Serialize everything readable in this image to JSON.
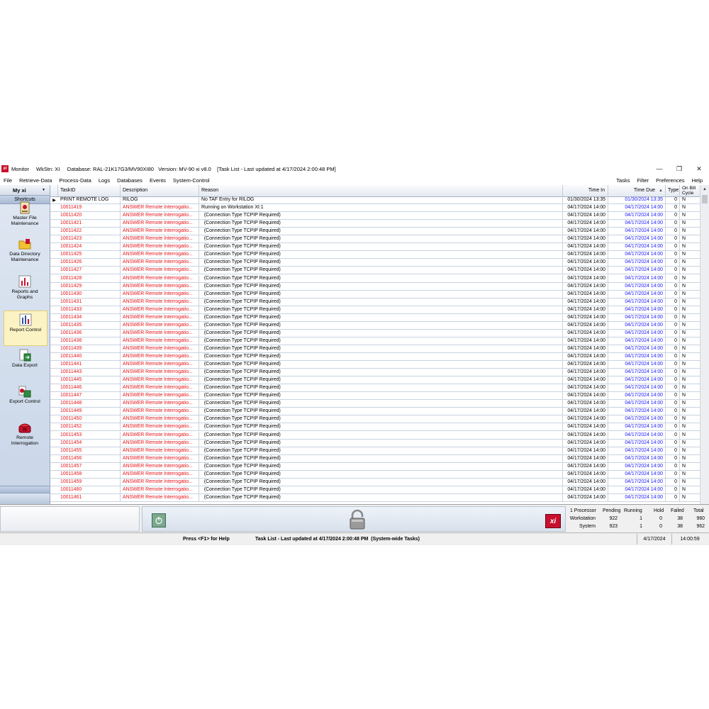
{
  "window": {
    "app_name": "Monitor",
    "logo_text": "xi",
    "title_info": "WkStn: XI     Database: RAL-21K17G3/MV90XI80   Version: MV-90 xi v8.0    [Task List - Last updated at 4/17/2024 2:00:48 PM]",
    "minimize": "—",
    "restore": "❐",
    "close": "✕"
  },
  "menu": {
    "left": [
      "File",
      "Retrieve-Data",
      "Process-Data",
      "Logs",
      "Databases",
      "Events",
      "System-Control"
    ],
    "right": [
      "Tasks",
      "Filter",
      "Preferences",
      "Help"
    ]
  },
  "sidebar": {
    "title": "My xi",
    "section": "Shortcuts",
    "items": [
      {
        "label": "Master File Maintenance",
        "icon": "master-file-icon",
        "selected": false
      },
      {
        "label": "Data Directory Maintenance",
        "icon": "folder-icon",
        "selected": false
      },
      {
        "label": "Reports and Graphs",
        "icon": "bar-chart-icon",
        "selected": false
      },
      {
        "label": "Report Control",
        "icon": "report-control-icon",
        "selected": true
      },
      {
        "label": "Data Export",
        "icon": "data-export-icon",
        "selected": false
      },
      {
        "label": "Export Control",
        "icon": "export-control-icon",
        "selected": false
      },
      {
        "label": "Remote Interrogation",
        "icon": "phone-icon",
        "selected": false
      }
    ]
  },
  "grid": {
    "columns": {
      "taskid": "TaskID",
      "description": "Description",
      "reason": "Reason",
      "time_in": "Time In",
      "time_due": "Time Due",
      "type": "Type",
      "on_bill_cycle": "On Bill Cycle"
    },
    "rows": [
      {
        "id": "PRINT REMOTE LOG",
        "desc": "RILOG",
        "reason": "No TAF Entry for RILOG",
        "time_in": "01/30/2024 13:35",
        "time_due": "01/30/2024 13:35",
        "type": "0",
        "bill": "N",
        "style": "normal"
      },
      {
        "id": "10011419",
        "desc": "ANSWER  Remote Interrogatio...",
        "reason": "Running on Workstation XI:1",
        "time_in": "04/17/2024 14:00",
        "time_due": "04/17/2024 14:00",
        "type": "0",
        "bill": "N",
        "style": "running"
      },
      {
        "id": "10011420",
        "desc": "ANSWER  Remote Interrogatio...",
        "reason": "  (Connection Type TCPIP Required)",
        "time_in": "04/17/2024 14:00",
        "time_due": "04/17/2024 14:00",
        "type": "0",
        "bill": "N",
        "style": "pending"
      },
      {
        "id": "10011421",
        "desc": "ANSWER  Remote Interrogatio...",
        "reason": "  (Connection Type TCPIP Required)",
        "time_in": "04/17/2024 14:00",
        "time_due": "04/17/2024 14:00",
        "type": "0",
        "bill": "N",
        "style": "pending"
      },
      {
        "id": "10011422",
        "desc": "ANSWER  Remote Interrogatio...",
        "reason": "  (Connection Type TCPIP Required)",
        "time_in": "04/17/2024 14:00",
        "time_due": "04/17/2024 14:00",
        "type": "0",
        "bill": "N",
        "style": "pending"
      },
      {
        "id": "10011423",
        "desc": "ANSWER  Remote Interrogatio...",
        "reason": "  (Connection Type TCPIP Required)",
        "time_in": "04/17/2024 14:00",
        "time_due": "04/17/2024 14:00",
        "type": "0",
        "bill": "N",
        "style": "pending"
      },
      {
        "id": "10011424",
        "desc": "ANSWER  Remote Interrogatio...",
        "reason": "  (Connection Type TCPIP Required)",
        "time_in": "04/17/2024 14:00",
        "time_due": "04/17/2024 14:00",
        "type": "0",
        "bill": "N",
        "style": "pending"
      },
      {
        "id": "10011425",
        "desc": "ANSWER  Remote Interrogatio...",
        "reason": "  (Connection Type TCPIP Required)",
        "time_in": "04/17/2024 14:00",
        "time_due": "04/17/2024 14:00",
        "type": "0",
        "bill": "N",
        "style": "pending"
      },
      {
        "id": "10011426",
        "desc": "ANSWER  Remote Interrogatio...",
        "reason": "  (Connection Type TCPIP Required)",
        "time_in": "04/17/2024 14:00",
        "time_due": "04/17/2024 14:00",
        "type": "0",
        "bill": "N",
        "style": "pending"
      },
      {
        "id": "10011427",
        "desc": "ANSWER  Remote Interrogatio...",
        "reason": "  (Connection Type TCPIP Required)",
        "time_in": "04/17/2024 14:00",
        "time_due": "04/17/2024 14:00",
        "type": "0",
        "bill": "N",
        "style": "pending"
      },
      {
        "id": "10011428",
        "desc": "ANSWER  Remote Interrogatio...",
        "reason": "  (Connection Type TCPIP Required)",
        "time_in": "04/17/2024 14:00",
        "time_due": "04/17/2024 14:00",
        "type": "0",
        "bill": "N",
        "style": "pending"
      },
      {
        "id": "10011429",
        "desc": "ANSWER  Remote Interrogatio...",
        "reason": "  (Connection Type TCPIP Required)",
        "time_in": "04/17/2024 14:00",
        "time_due": "04/17/2024 14:00",
        "type": "0",
        "bill": "N",
        "style": "pending"
      },
      {
        "id": "10011430",
        "desc": "ANSWER  Remote Interrogatio...",
        "reason": "  (Connection Type TCPIP Required)",
        "time_in": "04/17/2024 14:00",
        "time_due": "04/17/2024 14:00",
        "type": "0",
        "bill": "N",
        "style": "pending"
      },
      {
        "id": "10011431",
        "desc": "ANSWER  Remote Interrogatio...",
        "reason": "  (Connection Type TCPIP Required)",
        "time_in": "04/17/2024 14:00",
        "time_due": "04/17/2024 14:00",
        "type": "0",
        "bill": "N",
        "style": "pending"
      },
      {
        "id": "10011433",
        "desc": "ANSWER  Remote Interrogatio...",
        "reason": "  (Connection Type TCPIP Required)",
        "time_in": "04/17/2024 14:00",
        "time_due": "04/17/2024 14:00",
        "type": "0",
        "bill": "N",
        "style": "pending"
      },
      {
        "id": "10011434",
        "desc": "ANSWER  Remote Interrogatio...",
        "reason": "  (Connection Type TCPIP Required)",
        "time_in": "04/17/2024 14:00",
        "time_due": "04/17/2024 14:00",
        "type": "0",
        "bill": "N",
        "style": "pending"
      },
      {
        "id": "10011435",
        "desc": "ANSWER  Remote Interrogatio...",
        "reason": "  (Connection Type TCPIP Required)",
        "time_in": "04/17/2024 14:00",
        "time_due": "04/17/2024 14:00",
        "type": "0",
        "bill": "N",
        "style": "pending"
      },
      {
        "id": "10011436",
        "desc": "ANSWER  Remote Interrogatio...",
        "reason": "  (Connection Type TCPIP Required)",
        "time_in": "04/17/2024 14:00",
        "time_due": "04/17/2024 14:00",
        "type": "0",
        "bill": "N",
        "style": "pending"
      },
      {
        "id": "10011438",
        "desc": "ANSWER  Remote Interrogatio...",
        "reason": "  (Connection Type TCPIP Required)",
        "time_in": "04/17/2024 14:00",
        "time_due": "04/17/2024 14:00",
        "type": "0",
        "bill": "N",
        "style": "pending"
      },
      {
        "id": "10011439",
        "desc": "ANSWER  Remote Interrogatio...",
        "reason": "  (Connection Type TCPIP Required)",
        "time_in": "04/17/2024 14:00",
        "time_due": "04/17/2024 14:00",
        "type": "0",
        "bill": "N",
        "style": "pending"
      },
      {
        "id": "10011440",
        "desc": "ANSWER  Remote Interrogatio...",
        "reason": "  (Connection Type TCPIP Required)",
        "time_in": "04/17/2024 14:00",
        "time_due": "04/17/2024 14:00",
        "type": "0",
        "bill": "N",
        "style": "pending"
      },
      {
        "id": "10011441",
        "desc": "ANSWER  Remote Interrogatio...",
        "reason": "  (Connection Type TCPIP Required)",
        "time_in": "04/17/2024 14:00",
        "time_due": "04/17/2024 14:00",
        "type": "0",
        "bill": "N",
        "style": "pending"
      },
      {
        "id": "10011443",
        "desc": "ANSWER  Remote Interrogatio...",
        "reason": "  (Connection Type TCPIP Required)",
        "time_in": "04/17/2024 14:00",
        "time_due": "04/17/2024 14:00",
        "type": "0",
        "bill": "N",
        "style": "pending"
      },
      {
        "id": "10011445",
        "desc": "ANSWER  Remote Interrogatio...",
        "reason": "  (Connection Type TCPIP Required)",
        "time_in": "04/17/2024 14:00",
        "time_due": "04/17/2024 14:00",
        "type": "0",
        "bill": "N",
        "style": "pending"
      },
      {
        "id": "10011446",
        "desc": "ANSWER  Remote Interrogatio...",
        "reason": "  (Connection Type TCPIP Required)",
        "time_in": "04/17/2024 14:00",
        "time_due": "04/17/2024 14:00",
        "type": "0",
        "bill": "N",
        "style": "pending"
      },
      {
        "id": "10011447",
        "desc": "ANSWER  Remote Interrogatio...",
        "reason": "  (Connection Type TCPIP Required)",
        "time_in": "04/17/2024 14:00",
        "time_due": "04/17/2024 14:00",
        "type": "0",
        "bill": "N",
        "style": "pending"
      },
      {
        "id": "10011448",
        "desc": "ANSWER  Remote Interrogatio...",
        "reason": "  (Connection Type TCPIP Required)",
        "time_in": "04/17/2024 14:00",
        "time_due": "04/17/2024 14:00",
        "type": "0",
        "bill": "N",
        "style": "pending"
      },
      {
        "id": "10011449",
        "desc": "ANSWER  Remote Interrogatio...",
        "reason": "  (Connection Type TCPIP Required)",
        "time_in": "04/17/2024 14:00",
        "time_due": "04/17/2024 14:00",
        "type": "0",
        "bill": "N",
        "style": "pending"
      },
      {
        "id": "10011450",
        "desc": "ANSWER  Remote Interrogatio...",
        "reason": "  (Connection Type TCPIP Required)",
        "time_in": "04/17/2024 14:00",
        "time_due": "04/17/2024 14:00",
        "type": "0",
        "bill": "N",
        "style": "pending"
      },
      {
        "id": "10011452",
        "desc": "ANSWER  Remote Interrogatio...",
        "reason": "  (Connection Type TCPIP Required)",
        "time_in": "04/17/2024 14:00",
        "time_due": "04/17/2024 14:00",
        "type": "0",
        "bill": "N",
        "style": "pending"
      },
      {
        "id": "10011453",
        "desc": "ANSWER  Remote Interrogatio...",
        "reason": "  (Connection Type TCPIP Required)",
        "time_in": "04/17/2024 14:00",
        "time_due": "04/17/2024 14:00",
        "type": "0",
        "bill": "N",
        "style": "pending"
      },
      {
        "id": "10011454",
        "desc": "ANSWER  Remote Interrogatio...",
        "reason": "  (Connection Type TCPIP Required)",
        "time_in": "04/17/2024 14:00",
        "time_due": "04/17/2024 14:00",
        "type": "0",
        "bill": "N",
        "style": "pending"
      },
      {
        "id": "10011455",
        "desc": "ANSWER  Remote Interrogatio...",
        "reason": "  (Connection Type TCPIP Required)",
        "time_in": "04/17/2024 14:00",
        "time_due": "04/17/2024 14:00",
        "type": "0",
        "bill": "N",
        "style": "pending"
      },
      {
        "id": "10011456",
        "desc": "ANSWER  Remote Interrogatio...",
        "reason": "  (Connection Type TCPIP Required)",
        "time_in": "04/17/2024 14:00",
        "time_due": "04/17/2024 14:00",
        "type": "0",
        "bill": "N",
        "style": "pending"
      },
      {
        "id": "10011457",
        "desc": "ANSWER  Remote Interrogatio...",
        "reason": "  (Connection Type TCPIP Required)",
        "time_in": "04/17/2024 14:00",
        "time_due": "04/17/2024 14:00",
        "type": "0",
        "bill": "N",
        "style": "pending"
      },
      {
        "id": "10011458",
        "desc": "ANSWER  Remote Interrogatio...",
        "reason": "  (Connection Type TCPIP Required)",
        "time_in": "04/17/2024 14:00",
        "time_due": "04/17/2024 14:00",
        "type": "0",
        "bill": "N",
        "style": "pending"
      },
      {
        "id": "10011459",
        "desc": "ANSWER  Remote Interrogatio...",
        "reason": "  (Connection Type TCPIP Required)",
        "time_in": "04/17/2024 14:00",
        "time_due": "04/17/2024 14:00",
        "type": "0",
        "bill": "N",
        "style": "pending"
      },
      {
        "id": "10011460",
        "desc": "ANSWER  Remote Interrogatio...",
        "reason": "  (Connection Type TCPIP Required)",
        "time_in": "04/17/2024 14:00",
        "time_due": "04/17/2024 14:00",
        "type": "0",
        "bill": "N",
        "style": "pending"
      },
      {
        "id": "10011461",
        "desc": "ANSWER  Remote Interrogatio...",
        "reason": "  (Connection Type TCPIP Required)",
        "time_in": "04/17/2024 14:00",
        "time_due": "04/17/2024 14:00",
        "type": "0",
        "bill": "N",
        "style": "pending"
      }
    ]
  },
  "toolbar": {
    "power_icon": "power-icon",
    "lock_icon": "padlock-icon",
    "xi_logo": "xi"
  },
  "stats": {
    "headers": [
      "1 Processor",
      "Pending",
      "Running",
      "Hold",
      "Failed",
      "Total"
    ],
    "rows": [
      {
        "label": "Workstation",
        "pending": "922",
        "running": "1",
        "hold": "0",
        "failed": "38",
        "total": "960"
      },
      {
        "label": "System",
        "pending": "923",
        "running": "1",
        "hold": "0",
        "failed": "38",
        "total": "962"
      }
    ]
  },
  "status": {
    "help": "Press <F1> for Help",
    "task": "Task List - Last updated at 4/17/2024 2:00:48 PM  (System-wide Tasks)",
    "date": "4/17/2024",
    "time": "14:00:59"
  },
  "colors": {
    "pending_text": "#e8151b",
    "due_text": "#1a1aff",
    "selected_shortcut": "#fbf3c4",
    "brand": "#c8102e"
  }
}
